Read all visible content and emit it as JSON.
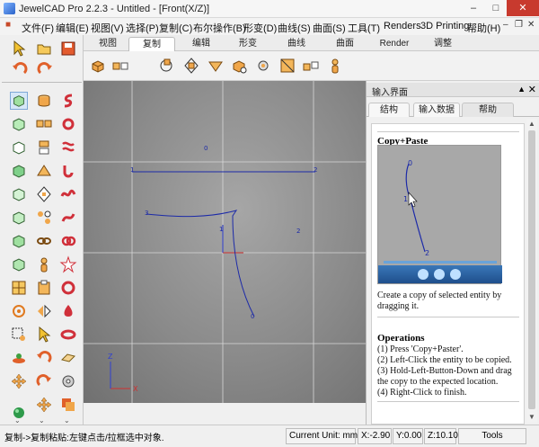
{
  "window": {
    "title": "JewelCAD Pro 2.2.3 - Untitled - [Front(X/Z)]"
  },
  "menu": [
    {
      "label": "文件(F)"
    },
    {
      "label": "编辑(E)"
    },
    {
      "label": "视图(V)"
    },
    {
      "label": "选择(P)"
    },
    {
      "label": "复制(C)"
    },
    {
      "label": "布尔操作(B)"
    },
    {
      "label": "形变(D)"
    },
    {
      "label": "曲线(S)"
    },
    {
      "label": "曲面(S)"
    },
    {
      "label": "工具(T)"
    },
    {
      "label": "Renders"
    },
    {
      "label": "3D Printing"
    },
    {
      "label": "帮助(H)"
    }
  ],
  "tabs": [
    {
      "label": "视图"
    },
    {
      "label": "复制"
    },
    {
      "label": "编辑"
    },
    {
      "label": "形变"
    },
    {
      "label": "曲线"
    },
    {
      "label": "曲面"
    },
    {
      "label": "Render"
    },
    {
      "label": "调整"
    }
  ],
  "viewport": {
    "axis_labels": {
      "x": "X",
      "z": "Z"
    },
    "point_labels": [
      "0",
      "1",
      "2",
      "3",
      "1",
      "2",
      "0"
    ]
  },
  "right_panel": {
    "title": "输入界面",
    "tabs": [
      {
        "label": "结构"
      },
      {
        "label": "输入数据"
      },
      {
        "label": "帮助"
      }
    ],
    "help_title": "Copy+Paste",
    "description": "Create a copy of selected entity by dragging it.",
    "operations_title": "Operations",
    "operations": [
      "(1) Press 'Copy+Paster'.",
      "(2) Left-Click the entity to be copied.",
      "(3) Hold-Left-Button-Down and drag the copy to the expected location.",
      "(4) Right-Click to finish."
    ],
    "video_point_labels": [
      "0",
      "1",
      "2"
    ]
  },
  "status": {
    "message": "复制->复制粘贴:左键点击/拉框选中对象.",
    "unit": "Current Unit:  mm",
    "x": "X:-2.90",
    "y": "Y:0.00",
    "z": "Z:10.10",
    "tools": "Tools"
  },
  "colors": {
    "curve": "#1c2aa8",
    "grid": "#d8d8d8",
    "axis_x": "#d03030",
    "axis_z": "#3040d0"
  }
}
